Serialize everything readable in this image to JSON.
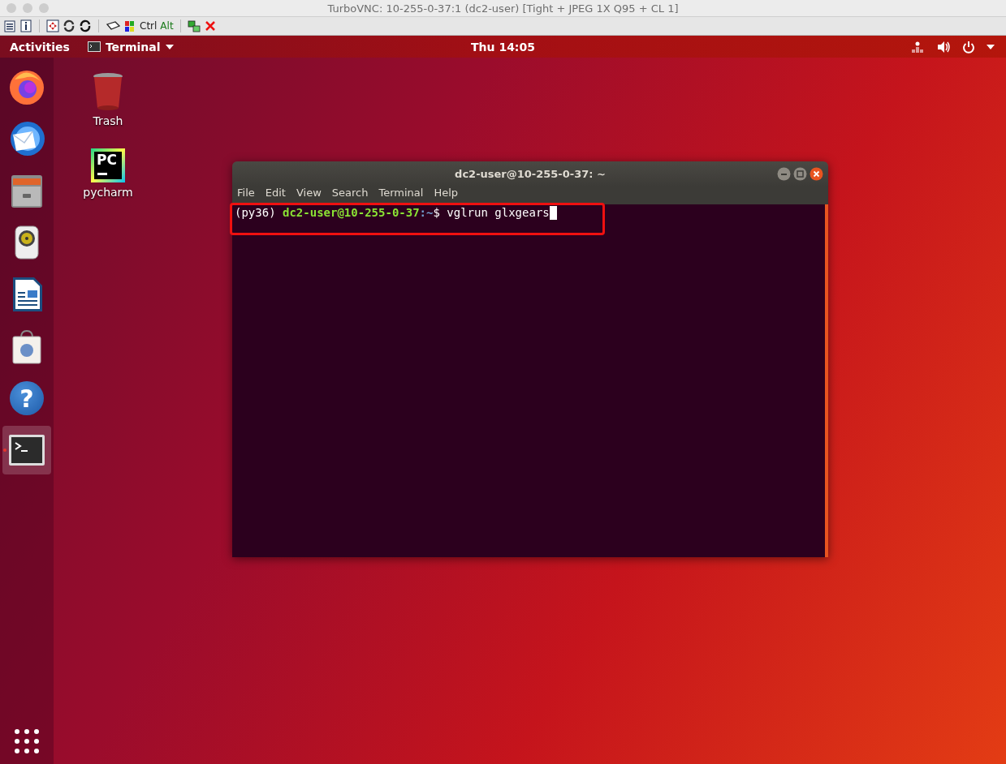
{
  "vnc_window": {
    "title": "TurboVNC: 10-255-0-37:1 (dc2-user) [Tight + JPEG 1X Q95 + CL 1]"
  },
  "vnc_toolbar": {
    "keys": [
      "Ctrl",
      "Alt"
    ]
  },
  "top_bar": {
    "activities": "Activities",
    "app_menu": "Terminal",
    "clock": "Thu 14:05"
  },
  "dock": {
    "items": [
      {
        "kind": "firefox",
        "selected": false,
        "running": false
      },
      {
        "kind": "thunderbird",
        "selected": false,
        "running": false
      },
      {
        "kind": "files",
        "selected": false,
        "running": false
      },
      {
        "kind": "rhythmbox",
        "selected": false,
        "running": false
      },
      {
        "kind": "writer",
        "selected": false,
        "running": false
      },
      {
        "kind": "software",
        "selected": false,
        "running": false
      },
      {
        "kind": "help",
        "glyph": "?",
        "selected": false,
        "running": false
      },
      {
        "kind": "terminal",
        "selected": true,
        "running": true
      }
    ]
  },
  "desktop_icons": [
    {
      "kind": "trash",
      "label": "Trash"
    },
    {
      "kind": "pycharm",
      "glyph": "PC",
      "label": "pycharm"
    }
  ],
  "terminal": {
    "title": "dc2-user@10-255-0-37: ~",
    "menu": [
      "File",
      "Edit",
      "View",
      "Search",
      "Terminal",
      "Help"
    ],
    "prompt": {
      "env": "(py36)",
      "user_host": "dc2-user@10-255-0-37",
      "path": ":~",
      "symbol": "$",
      "command": "vglrun glxgears"
    },
    "highlighted": true
  }
}
